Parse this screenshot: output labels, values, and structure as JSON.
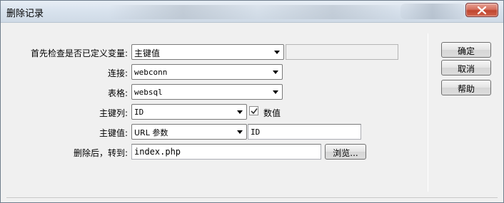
{
  "window": {
    "title": "删除记录"
  },
  "form": {
    "first_check": {
      "label": "首先检查是否已定义变量:",
      "select_value": "主键值",
      "text_value": ""
    },
    "connection": {
      "label": "连接:",
      "select_value": "webconn"
    },
    "table": {
      "label": "表格:",
      "select_value": "websql"
    },
    "primary_key_column": {
      "label": "主键列:",
      "select_value": "ID",
      "numeric_label": "数值",
      "numeric_checked": true
    },
    "primary_key_value": {
      "label": "主键值:",
      "select_value": "URL 参数",
      "text_value": "ID"
    },
    "after_delete": {
      "label": "删除后，转到:",
      "text_value": "index.php",
      "browse_label": "浏览..."
    }
  },
  "buttons": {
    "ok": "确定",
    "cancel": "取消",
    "help": "帮助"
  }
}
